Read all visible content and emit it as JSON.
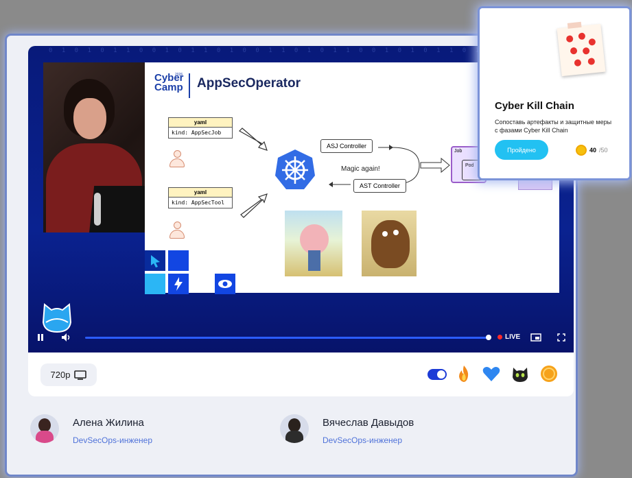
{
  "player": {
    "binary_strip": "0 1 0 1 0 1 1 0 0 1 0 1 1 0 1 0 0 1 1 0 1 0 1 1 0 0 1 0 1 0 1 1 0 1 0 1",
    "slide": {
      "logo_line1": "Cyber",
      "logo_line2": "Camp",
      "logo_year": "2026",
      "title": "AppSecOperator",
      "yaml1_header": "yaml",
      "yaml1_body": "kind: AppSecJob",
      "yaml2_header": "yaml",
      "yaml2_body": "kind: AppSecTool",
      "asj_controller": "ASJ Controller",
      "ast_controller": "AST Controller",
      "magic": "Magic again!",
      "job": "Job",
      "pod": "Pod"
    },
    "live_label": "LIVE",
    "progress": 1.0
  },
  "toolbar": {
    "quality": "720p",
    "reactions": [
      "fire",
      "blue-heart",
      "black-cat",
      "coin"
    ]
  },
  "speakers": [
    {
      "name": "Алена Жилина",
      "role": "DevSecOps-инженер"
    },
    {
      "name": "Вячеслав Давыдов",
      "role": "DevSecOps-инженер"
    }
  ],
  "popup": {
    "title": "Cyber Kill Chain",
    "description": "Сопоставь артефакты и защитные меры с фазами Cyber Kill Chain",
    "button": "Пройдено",
    "score": "40",
    "score_total": "/50"
  }
}
